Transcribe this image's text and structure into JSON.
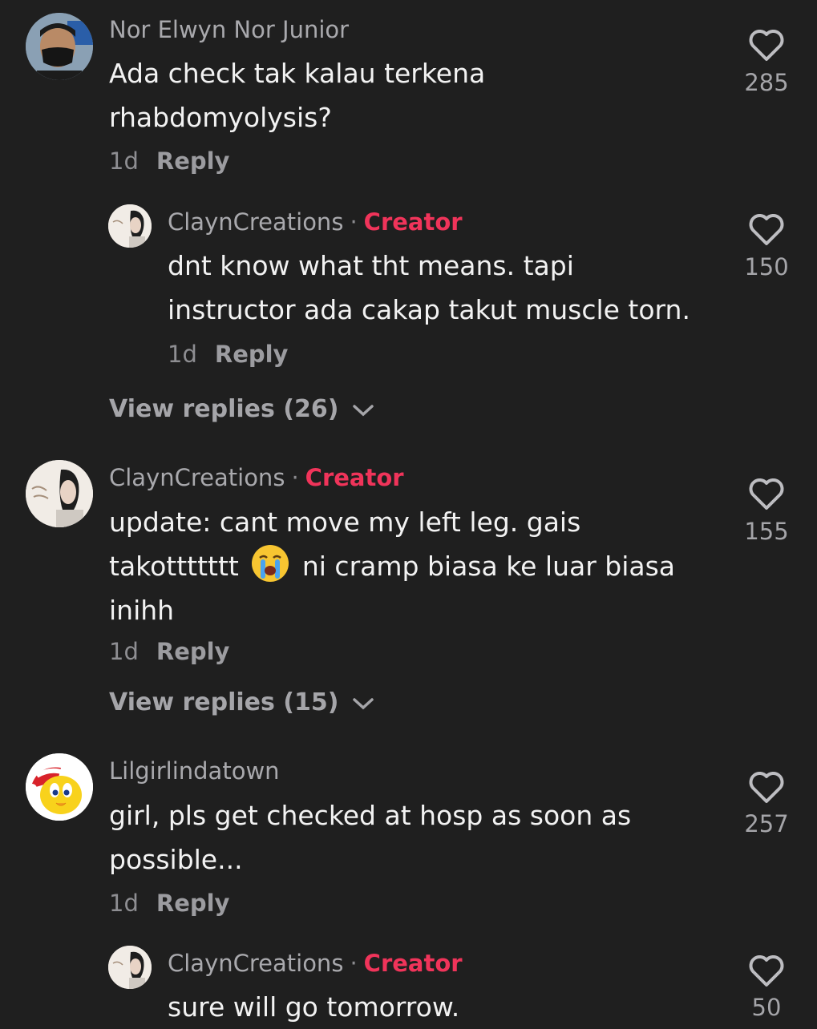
{
  "colors": {
    "background": "#1f1f1f",
    "creator_badge": "#f0345a"
  },
  "comments": [
    {
      "username": "Nor Elwyn Nor Junior",
      "text_lines": [
        "Ada check tak kalau terkena",
        "rhabdomyolysis?"
      ],
      "time": "1d",
      "reply_label": "Reply",
      "likes": "285",
      "avatar_icon": "masked-person-avatar"
    },
    {
      "username": "ClaynCreations",
      "badge": "Creator",
      "text_lines": [
        "dnt know what tht means. tapi",
        "instructor ada cakap takut muscle torn."
      ],
      "time": "1d",
      "reply_label": "Reply",
      "likes": "150",
      "avatar_icon": "clayn-creations-avatar"
    },
    {
      "view_replies": "View replies (26)"
    },
    {
      "username": "ClaynCreations",
      "badge": "Creator",
      "text_line1": "update: cant move my left leg. gais",
      "text_line2a": "takottttttt",
      "emoji": "crying-face",
      "text_line2b": "ni cramp biasa ke luar biasa",
      "text_line3": "inihh",
      "time": "1d",
      "reply_label": "Reply",
      "likes": "155",
      "avatar_icon": "clayn-creations-avatar"
    },
    {
      "view_replies": "View replies (15)"
    },
    {
      "username": "Lilgirlindatown",
      "text_lines": [
        "girl, pls get checked at hosp as soon as",
        "possible..."
      ],
      "time": "1d",
      "reply_label": "Reply",
      "likes": "257",
      "avatar_icon": "tweety-bird-avatar"
    },
    {
      "username": "ClaynCreations",
      "badge": "Creator",
      "text_lines": [
        "sure will go tomorrow."
      ],
      "likes": "50",
      "avatar_icon": "clayn-creations-avatar"
    }
  ],
  "separator": "·"
}
